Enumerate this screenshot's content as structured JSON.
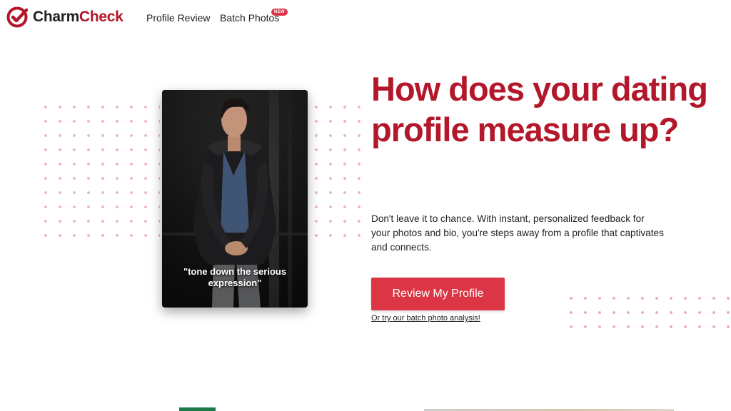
{
  "header": {
    "logo": {
      "part1": "Charm",
      "part2": "Check",
      "icon": "check-circle-icon"
    },
    "nav": [
      {
        "label": "Profile Review"
      },
      {
        "label": "Batch Photos",
        "badge": "NEW"
      }
    ]
  },
  "hero": {
    "photo_caption": "\"tone down the serious expression\"",
    "title": "How does your dating profile measure up?",
    "body": "Don't leave it to chance. With instant, personalized feedback for your photos and bio, you're steps away from a profile that captivates and connects.",
    "cta_label": "Review My Profile",
    "secondary_link": "Or try our batch photo analysis!"
  },
  "colors": {
    "brand": "#b3172a",
    "button": "#dc3545",
    "dots": "#e8b2b8"
  }
}
